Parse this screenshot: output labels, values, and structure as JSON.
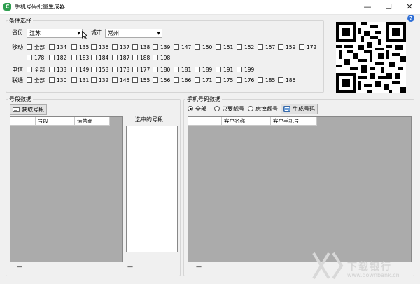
{
  "window": {
    "title": "手机号码批量生成器",
    "minimize": "—",
    "maximize": "☐",
    "close": "✕"
  },
  "conditions": {
    "legend": "条件选择",
    "province_label": "省份",
    "province_value": "江苏",
    "city_label": "城市",
    "city_value": "常州",
    "operators": [
      {
        "label": "移动",
        "all": "全部",
        "prefixes": [
          "134",
          "135",
          "136",
          "137",
          "138",
          "139",
          "147",
          "150",
          "151",
          "152",
          "157",
          "159",
          "172",
          "178",
          "182",
          "183",
          "184",
          "187",
          "188",
          "198"
        ]
      },
      {
        "label": "电信",
        "all": "全部",
        "prefixes": [
          "133",
          "149",
          "153",
          "173",
          "177",
          "180",
          "181",
          "189",
          "191",
          "199"
        ]
      },
      {
        "label": "联通",
        "all": "全部",
        "prefixes": [
          "130",
          "131",
          "132",
          "145",
          "155",
          "156",
          "166",
          "171",
          "175",
          "176",
          "185",
          "186"
        ]
      }
    ]
  },
  "segments": {
    "legend": "号段数据",
    "fetch_button": "获取号段",
    "columns": [
      "号段",
      "运营商"
    ],
    "selected_label": "选中的号段",
    "status_left": "—",
    "status_right": "—"
  },
  "phones": {
    "legend": "手机号码数据",
    "radios": [
      {
        "label": "全部",
        "checked": true
      },
      {
        "label": "只要靓号",
        "checked": false
      },
      {
        "label": "虑掉靓号",
        "checked": false
      }
    ],
    "generate_button": "生成号码",
    "columns": [
      "客户名称",
      "客户手机号"
    ],
    "status": "—"
  },
  "help_icon": "?",
  "app_icon_glyph": "C",
  "watermark": {
    "text": "下载银行",
    "url": "www.downbank.cn"
  },
  "icons": {
    "app": "app-icon",
    "help": "help-icon",
    "qr": "qr-code-icon",
    "fetch": "fetch-icon",
    "generate": "generate-icon"
  }
}
